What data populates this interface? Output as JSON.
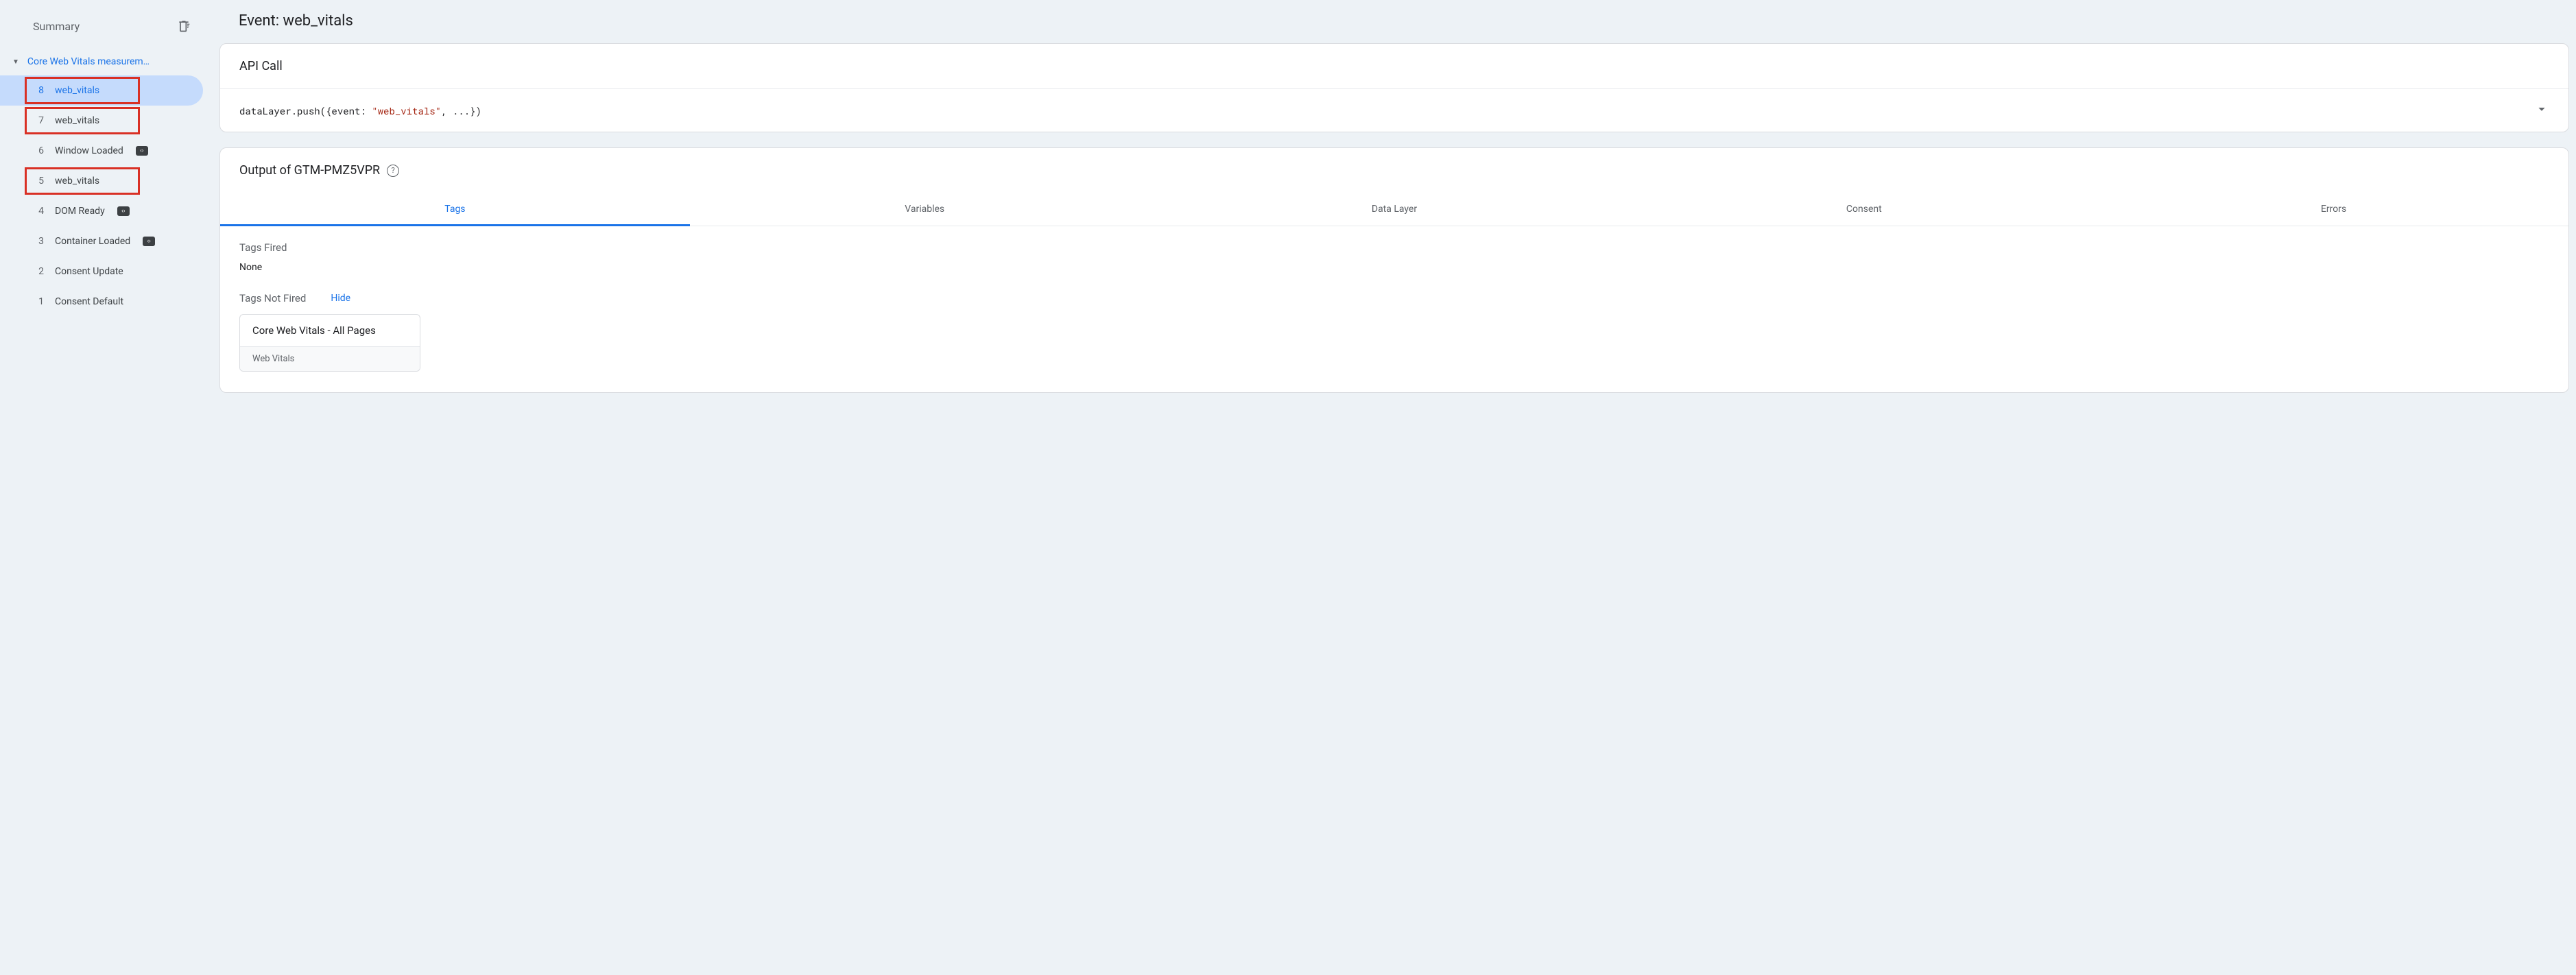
{
  "sidebar": {
    "title": "Summary",
    "group_title": "Core Web Vitals measurem…",
    "events": [
      {
        "num": "8",
        "label": "web_vitals",
        "selected": true,
        "badge": false,
        "annot": true
      },
      {
        "num": "7",
        "label": "web_vitals",
        "selected": false,
        "badge": false,
        "annot": true
      },
      {
        "num": "6",
        "label": "Window Loaded",
        "selected": false,
        "badge": true,
        "annot": false
      },
      {
        "num": "5",
        "label": "web_vitals",
        "selected": false,
        "badge": false,
        "annot": true
      },
      {
        "num": "4",
        "label": "DOM Ready",
        "selected": false,
        "badge": true,
        "annot": false
      },
      {
        "num": "3",
        "label": "Container Loaded",
        "selected": false,
        "badge": true,
        "annot": false
      },
      {
        "num": "2",
        "label": "Consent Update",
        "selected": false,
        "badge": false,
        "annot": false
      },
      {
        "num": "1",
        "label": "Consent Default",
        "selected": false,
        "badge": false,
        "annot": false
      }
    ]
  },
  "main": {
    "title": "Event: web_vitals",
    "api_call": {
      "header": "API Call",
      "code_prefix": "dataLayer.push({event: ",
      "code_string": "\"web_vitals\"",
      "code_suffix": ", ...})"
    },
    "output": {
      "header": "Output of GTM-PMZ5VPR",
      "tabs": [
        "Tags",
        "Variables",
        "Data Layer",
        "Consent",
        "Errors"
      ],
      "active_tab": 0,
      "tags_fired_label": "Tags Fired",
      "tags_fired_value": "None",
      "tags_not_fired_label": "Tags Not Fired",
      "hide_label": "Hide",
      "not_fired_tag": {
        "title": "Core Web Vitals - All Pages",
        "subtitle": "Web Vitals"
      }
    }
  }
}
